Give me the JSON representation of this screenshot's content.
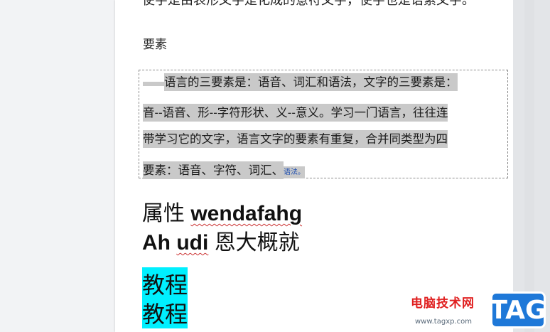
{
  "document": {
    "top_line_cut": "使字是由表形文字是化成的意符文字，使字也是语素文字。",
    "heading": "要素",
    "textbox_lines": [
      "语言的三要素是：语音、词汇和语法，文字的三要素是：",
      "音--语音、形--字符形状、义--意义。学习一门语言，往往连",
      "带学习它的文字，语言文字的要素有重复，合并同类型为四",
      "要素：语音、字符、词汇、"
    ],
    "textbox_tail_link": "语法。",
    "line_attr_cjk": "属性",
    "line_attr_en": "wendafahg",
    "line2_en_a": "Ah",
    "line2_en_b": "udi",
    "line2_cjk": "恩大概就",
    "cyan_lines": [
      "教程",
      "教程"
    ]
  },
  "watermark": {
    "site_name": "电脑技术网",
    "url": "www.tagxp.com",
    "tag": "TAG"
  },
  "colors": {
    "highlight_gray": "#c9c9c9",
    "highlight_cyan": "#00f0ff",
    "watermark_red": "#e02020",
    "tag_blue": "#1e78d8"
  }
}
